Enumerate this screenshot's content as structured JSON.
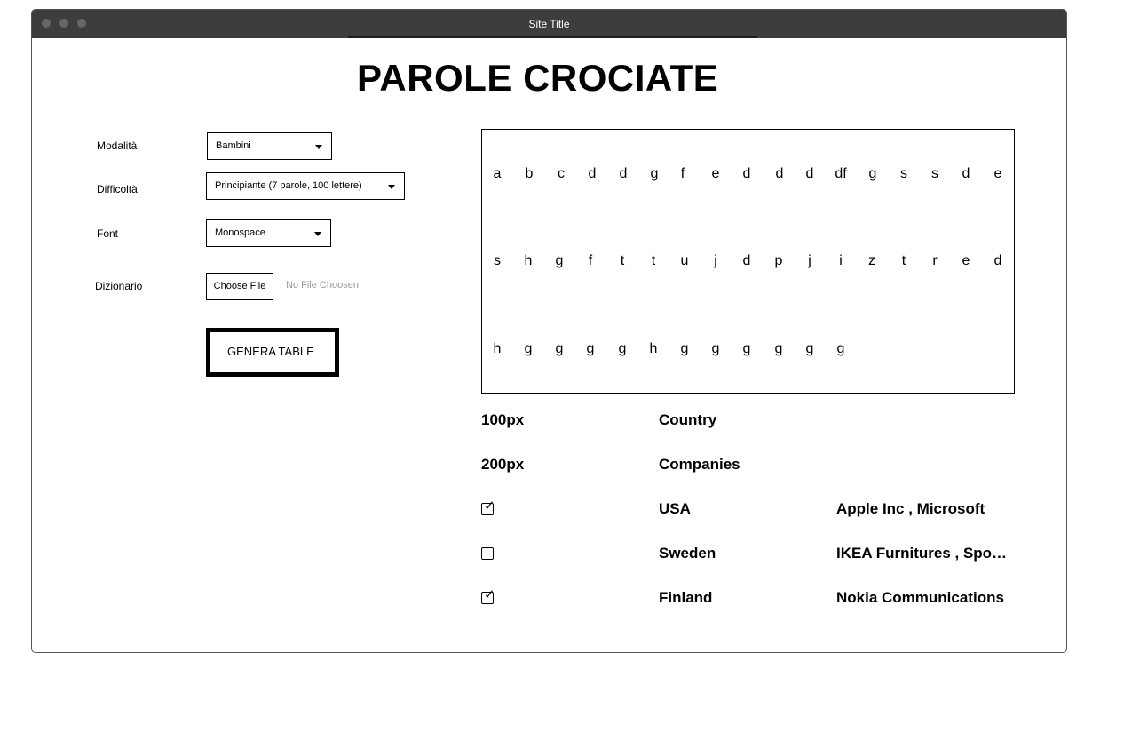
{
  "window": {
    "title": "Site Title"
  },
  "page": {
    "title": "PAROLE CROCIATE"
  },
  "form": {
    "mode": {
      "label": "Modalità",
      "value": "Bambini"
    },
    "difficulty": {
      "label": "Difficoltà",
      "value": "Principiante (7 parole, 100 lettere)"
    },
    "font": {
      "label": "Font",
      "value": "Monospace"
    },
    "dictionary": {
      "label": "Dizionario",
      "button": "Choose File",
      "status": "No File Choosen"
    },
    "generate_label": "GENERA TABLE"
  },
  "grid": {
    "rows": [
      [
        "a",
        "b",
        "c",
        "d",
        "d",
        "g",
        "f",
        "e",
        "d",
        "d",
        "d",
        "df",
        "g",
        "s",
        "s",
        "d",
        "e"
      ],
      [
        "s",
        "h",
        "g",
        "f",
        "t",
        "t",
        "u",
        "j",
        "d",
        "p",
        "j",
        "i",
        "z",
        "t",
        "r",
        "e",
        "d"
      ],
      [
        "h",
        "g",
        "g",
        "g",
        "g",
        "h",
        "g",
        "g",
        "g",
        "g",
        "g",
        "g"
      ]
    ]
  },
  "table": {
    "headers": [
      {
        "col1": "100px",
        "col2": "Country"
      },
      {
        "col1": "200px",
        "col2": "Companies"
      }
    ],
    "rows": [
      {
        "checked": true,
        "country": "USA",
        "companies": "Apple Inc , Microsoft"
      },
      {
        "checked": false,
        "country": "Sweden",
        "companies": "IKEA Furnitures , Spo…"
      },
      {
        "checked": true,
        "country": "Finland",
        "companies": "Nokia Communications"
      }
    ]
  }
}
